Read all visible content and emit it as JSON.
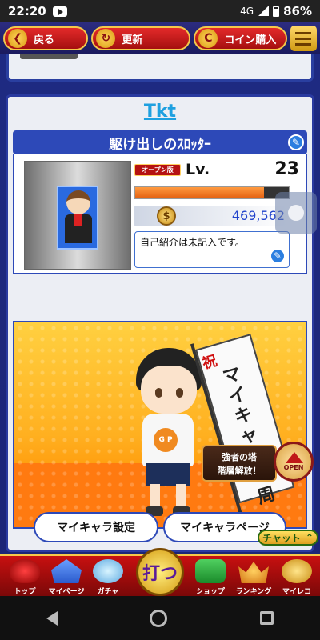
{
  "status_bar": {
    "time": "22:20",
    "network": "4G",
    "battery": "86%"
  },
  "top_nav": {
    "back_label": "戻る",
    "refresh_label": "更新",
    "coin_label": "コイン購入"
  },
  "profile": {
    "username": "Tkt",
    "title": "駆け出しのｽﾛｯﾀｰ",
    "badge": "オープン版",
    "level_label": "Lv.",
    "level": "23",
    "exp_progress": 0.84,
    "coins": "469,562",
    "intro": "自己紹介は未記入です。"
  },
  "scene": {
    "banner_top": "祝",
    "banner_text": "マイキャラ一周",
    "tower_notice_line1": "強者の塔",
    "tower_notice_line2": "階層解放！",
    "open_label": "OPEN",
    "shirt_logo": "G P"
  },
  "buttons": {
    "my_chara_settings": "マイキャラ設定",
    "my_chara_page": "マイキャラページ",
    "chat": "チャット"
  },
  "bottom_nav": {
    "top": "トップ",
    "mypage": "マイページ",
    "gacha": "ガチャ",
    "center": "打つ",
    "shop": "ショップ",
    "ranking": "ランキング",
    "mycollection": "マイレコ"
  },
  "colors": {
    "accent_red": "#c81010",
    "gold": "#f6c84a",
    "panel_blue": "#2d49b8",
    "coin_text": "#2244cc"
  }
}
